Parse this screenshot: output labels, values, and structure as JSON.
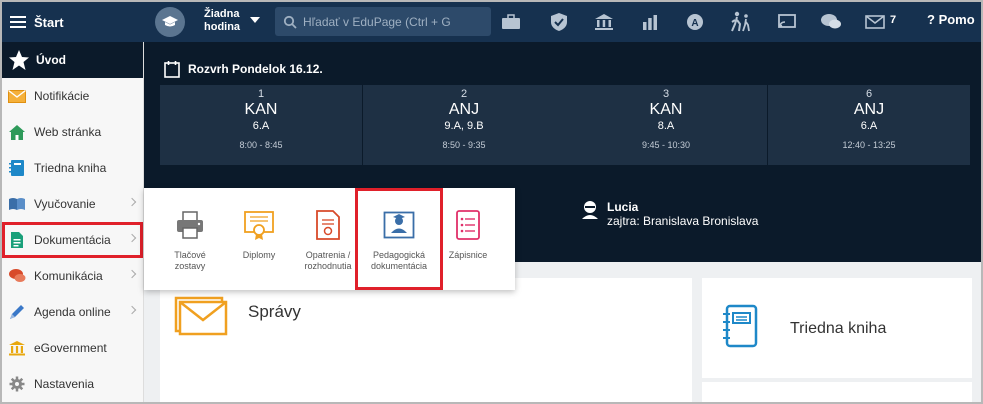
{
  "topbar": {
    "start_label": "Štart",
    "hour_line1": "Žiadna",
    "hour_line2": "hodina",
    "search_placeholder": "Hľadať v EduPage (Ctrl + G",
    "messages_count": "7",
    "help_label": "Pomo"
  },
  "sidebar": {
    "home_label": "Úvod",
    "items": [
      {
        "label": "Notifikácie",
        "icon": "envelope-icon",
        "color": "#f0a020"
      },
      {
        "label": "Web stránka",
        "icon": "house-icon",
        "color": "#2e9a5a"
      },
      {
        "label": "Triedna kniha",
        "icon": "book-icon",
        "color": "#1e88c8"
      },
      {
        "label": "Vyučovanie",
        "icon": "open-book-icon",
        "color": "#3a6ea8"
      },
      {
        "label": "Dokumentácia",
        "icon": "document-icon",
        "color": "#1aa07a"
      },
      {
        "label": "Komunikácia",
        "icon": "chat-icon",
        "color": "#d84a2a"
      },
      {
        "label": "Agenda online",
        "icon": "pen-icon",
        "color": "#3a78c8"
      },
      {
        "label": "eGovernment",
        "icon": "government-icon",
        "color": "#e8a810"
      },
      {
        "label": "Nastavenia",
        "icon": "gear-icon",
        "color": "#888888"
      }
    ]
  },
  "timetable": {
    "title": "Rozvrh Pondelok 16.12.",
    "lessons": [
      {
        "num": "1",
        "subject": "KAN",
        "class": "6.A",
        "time": "8:00 - 8:45"
      },
      {
        "num": "2",
        "subject": "ANJ",
        "class": "9.A, 9.B",
        "time": "8:50 - 9:35"
      },
      {
        "num": "3",
        "subject": "KAN",
        "class": "8.A",
        "time": "9:45 - 10:30"
      },
      {
        "num": "6",
        "subject": "ANJ",
        "class": "6.A",
        "time": "12:40 - 13:25"
      }
    ]
  },
  "substitute": {
    "name": "Lucia",
    "detail": "zajtra: Branislava Bronislava"
  },
  "popup": {
    "items": [
      {
        "line1": "Tlačové",
        "line2": "zostavy",
        "icon": "printer-icon"
      },
      {
        "line1": "Diplomy",
        "line2": "",
        "icon": "diploma-icon"
      },
      {
        "line1": "Opatrenia /",
        "line2": "rozhodnutia",
        "icon": "decision-icon"
      },
      {
        "line1": "Pedagogická",
        "line2": "dokumentácia",
        "icon": "pedagogical-doc-icon"
      },
      {
        "line1": "Zápisnice",
        "line2": "",
        "icon": "minutes-icon"
      }
    ]
  },
  "cards": {
    "spravy": "Správy",
    "triedna_kniha": "Triedna kniha"
  },
  "colors": {
    "topbar": "#16314f",
    "dark_panel": "#0b1a2a",
    "lesson_cell": "#1e3044",
    "highlight": "#e0202a"
  }
}
